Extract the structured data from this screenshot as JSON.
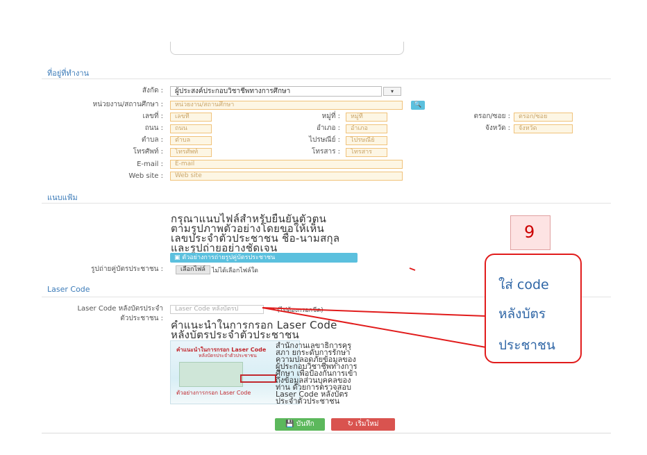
{
  "workplace": {
    "section_title": "ที่อยู่ที่ทำงาน",
    "affiliation_label": "สังกัด :",
    "affiliation_value": "ผู้ประสงค์ประกอบวิชาชีพทางการศึกษา",
    "affiliation_btn": "▾",
    "agency_label": "หน่วยงาน/สถานศึกษา :",
    "agency_placeholder": "หน่วยงาน/สถานศึกษา",
    "search_btn": "🔍",
    "houseno_label": "เลขที่ :",
    "houseno_placeholder": "เลขที่",
    "moo_label": "หมู่ที่ :",
    "moo_placeholder": "หมู่ที่",
    "soi_label": "ตรอก/ซอย :",
    "soi_placeholder": "ตรอก/ซอย",
    "road_label": "ถนน :",
    "road_placeholder": "ถนน",
    "district_label": "อำเภอ :",
    "district_placeholder": "อำเภอ",
    "province_label": "จังหวัด :",
    "province_placeholder": "จังหวัด",
    "subdistrict_label": "ตำบล :",
    "subdistrict_placeholder": "ตำบล",
    "postcode_label": "ไปรษณีย์ :",
    "postcode_placeholder": "ไปรษณีย์",
    "phone_label": "โทรศัพท์ :",
    "phone_placeholder": "โทรศัพท์",
    "fax_label": "โทรสาร :",
    "fax_placeholder": "โทรสาร",
    "email_label": "E-mail :",
    "email_placeholder": "E-mail",
    "website_label": "Web site :",
    "website_placeholder": "Web site"
  },
  "attachment": {
    "section_title": "แนบแฟ้ม",
    "instruction_lines": [
      "กรุณาแนบไฟล์สำหรับยืนยันตัวตน",
      "ตามรูปภาพตัวอย่างโดยขอให้เห็น",
      "เลขประจำตัวประชาชน ชื่อ-นามสกุล",
      "และรูปถ่ายอย่างชัดเจน"
    ],
    "example_btn": "ตัวอย่างการถ่ายรูปคู่บัตรประชาชน",
    "photo_label": "รูปถ่ายคู่บัตรประชาชน :",
    "choose_file_btn": "เลือกไฟล์",
    "no_file_text": "ไม่ได้เลือกไฟล์ใด"
  },
  "laser": {
    "section_title": "Laser Code",
    "field_label_line1": "Laser Code หลังบัตรประจำ",
    "field_label_line2": "ตัวประชาชน :",
    "field_placeholder": "Laser Code หลังบัตรป",
    "note": "* (ไม่ต้องกรอกขีด)",
    "guide_title_line1": "คำแนะนำในการกรอก Laser Code",
    "guide_title_line2": "หลังบัตรประจำตัวประชาชน",
    "card_title": "คำแนะนำในการกรอก Laser Code",
    "card_subtitle": "หลังบัตรประจำตัวประชาชน",
    "card_footer": "ตัวอย่างการกรอก Laser Code",
    "card_overlay_lines": [
      "สำนักงานเลขาธิการคุรุ",
      "สภา ยกระดับการรักษา",
      "ความปลอดภัยข้อมูลของ",
      "ผู้ประกอบวิชาชีพทางการ",
      "ศึกษา เพื่อป้องกันการเข้า",
      "ถึงข้อมูลส่วนบุคคลของ",
      "ท่าน ด้วยการตรวจสอบ",
      "Laser Code หลังบัตร",
      "ประจำตัวประชาชน"
    ]
  },
  "annotation": {
    "number_box": "9",
    "callout_lines": [
      "ใส่ code",
      "หลังบัตร",
      "ประชาชน"
    ],
    "arrow_color": "#e11b1b"
  },
  "actions": {
    "save_label": "💾 บันทึก",
    "reset_label": "↻ เริ่มใหม่"
  }
}
